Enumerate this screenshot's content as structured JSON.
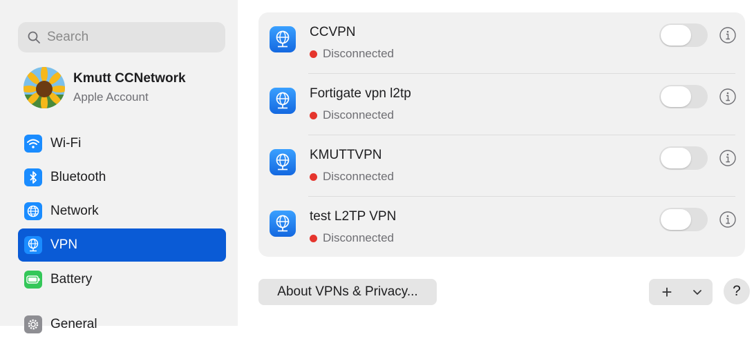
{
  "sidebar": {
    "search": {
      "placeholder": "Search",
      "icon": "magnifier"
    },
    "account": {
      "name": "Kmutt CCNetwork",
      "subtitle": "Apple Account",
      "avatar": "sunflower-photo"
    },
    "items": [
      {
        "label": "Wi-Fi",
        "icon": "wifi-icon",
        "color": "#1a8cff",
        "selected": false
      },
      {
        "label": "Bluetooth",
        "icon": "bluetooth-icon",
        "color": "#1a8cff",
        "selected": false
      },
      {
        "label": "Network",
        "icon": "globe-icon",
        "color": "#1a8cff",
        "selected": false
      },
      {
        "label": "VPN",
        "icon": "vpn-globe-icon",
        "color": "#1a8cff",
        "selected": true
      },
      {
        "label": "Battery",
        "icon": "battery-icon",
        "color": "#34c759",
        "selected": false
      },
      {
        "label": "General",
        "icon": "gear-icon",
        "color": "#8e8e93",
        "selected": false
      }
    ],
    "selected_color": "#0a5bd6"
  },
  "vpns": [
    {
      "name": "CCVPN",
      "status": "Disconnected",
      "enabled": false
    },
    {
      "name": "Fortigate vpn l2tp",
      "status": "Disconnected",
      "enabled": false
    },
    {
      "name": "KMUTTVPN",
      "status": "Disconnected",
      "enabled": false
    },
    {
      "name": "test L2TP VPN",
      "status": "Disconnected",
      "enabled": false
    }
  ],
  "status_color": "#e5352d",
  "footer": {
    "about_label": "About VPNs & Privacy...",
    "add_label": "+",
    "help_label": "?"
  }
}
